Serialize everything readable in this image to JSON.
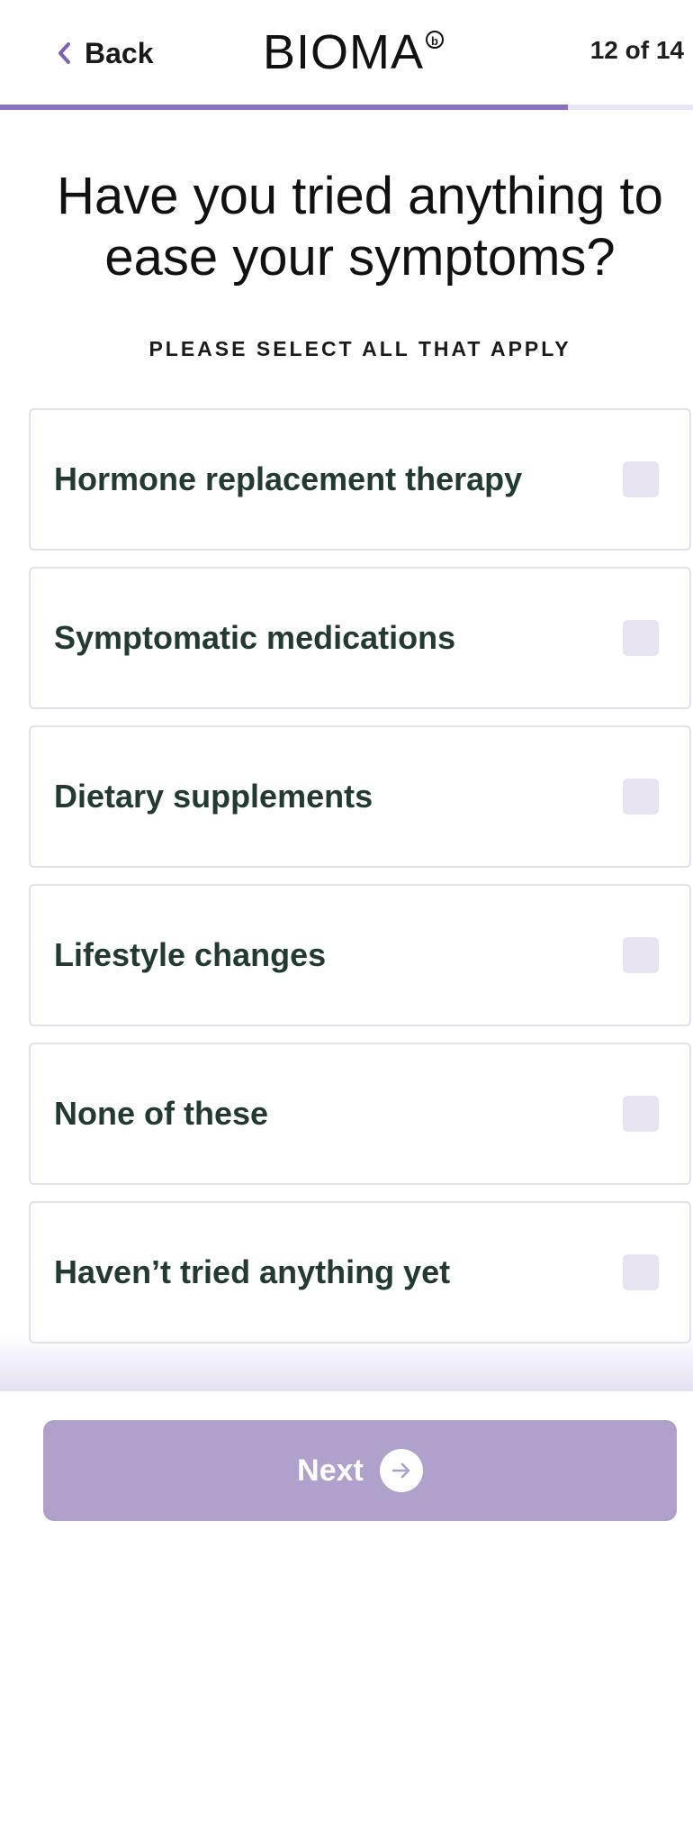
{
  "header": {
    "back_label": "Back",
    "logo_text": "BIOMA",
    "logo_mark": "b",
    "step_counter": "12 of 14"
  },
  "progress": {
    "current_step": 12,
    "total_steps": 14,
    "fraction": 0.82,
    "fill_color": "#8a70bf",
    "track_color": "#e9e5f4"
  },
  "question": {
    "title": "Have you tried anything to ease your symptoms?",
    "instruction": "PLEASE SELECT ALL THAT APPLY"
  },
  "options": [
    {
      "label": "Hormone replacement therapy",
      "checked": false
    },
    {
      "label": "Symptomatic medications",
      "checked": false
    },
    {
      "label": "Dietary supplements",
      "checked": false
    },
    {
      "label": "Lifestyle changes",
      "checked": false
    },
    {
      "label": "None of these",
      "checked": false
    },
    {
      "label": "Haven’t tried anything yet",
      "checked": false
    }
  ],
  "footer": {
    "next_label": "Next",
    "next_icon": "arrow-right-icon",
    "next_color": "#afa0cc"
  },
  "icons": {
    "back": "chevron-left-icon"
  }
}
